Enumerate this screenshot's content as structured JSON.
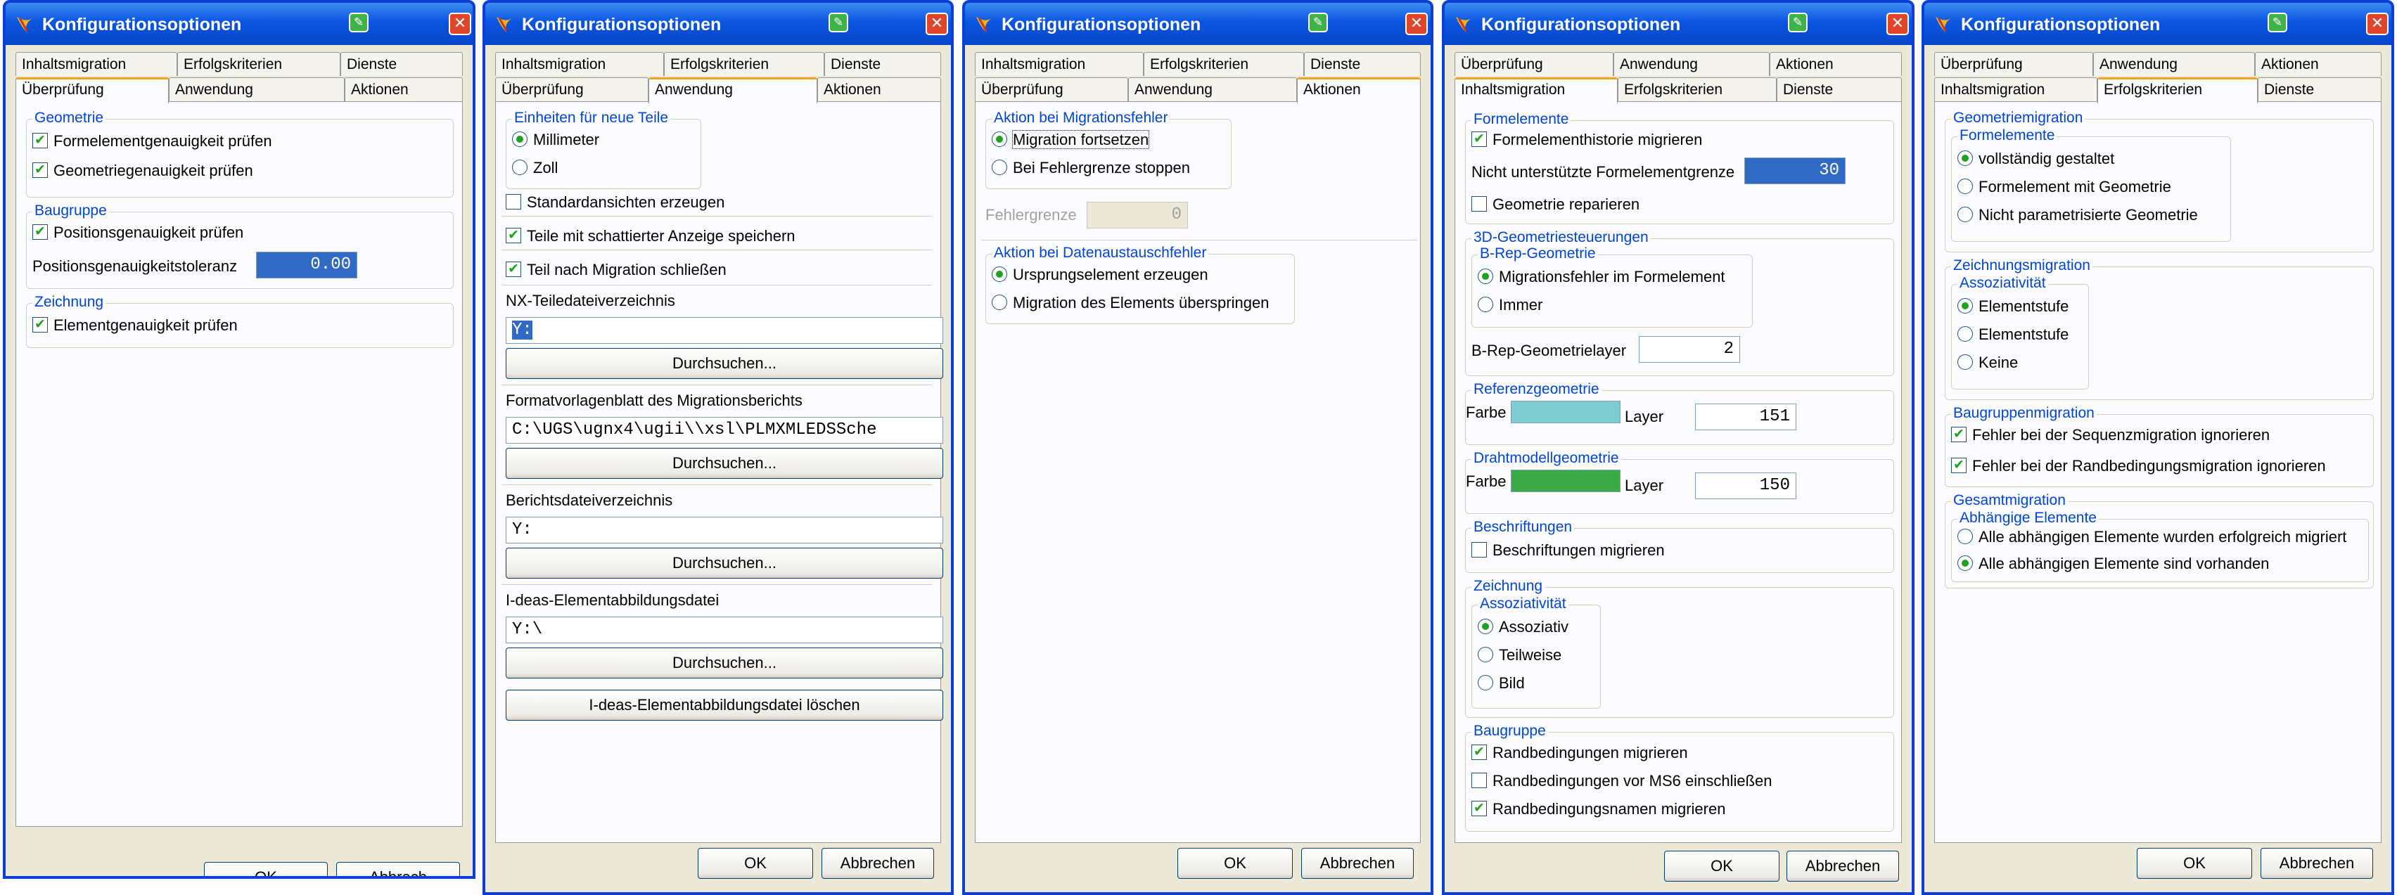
{
  "window_title": "Konfigurationsoptionen",
  "buttons": {
    "ok": "OK",
    "cancel": "Abbrechen",
    "cancel_partial": "Abbrech"
  },
  "tabs": {
    "inhaltsmigration": "Inhaltsmigration",
    "erfolgskriterien": "Erfolgskriterien",
    "dienste": "Dienste",
    "ueberpruefung": "Überprüfung",
    "anwendung": "Anwendung",
    "aktionen": "Aktionen"
  },
  "d1": {
    "geometrie": {
      "title": "Geometrie",
      "formelement": "Formelementgenauigkeit prüfen",
      "geometrie_pruefen": "Geometriegenauigkeit prüfen"
    },
    "baugruppe": {
      "title": "Baugruppe",
      "position": "Positionsgenauigkeit prüfen",
      "tol_label": "Positionsgenauigkeitstoleranz",
      "tol_value": "0.00"
    },
    "zeichnung": {
      "title": "Zeichnung",
      "element": "Elementgenauigkeit prüfen"
    }
  },
  "d2": {
    "einheiten": {
      "title": "Einheiten für neue Teile",
      "mm": "Millimeter",
      "zoll": "Zoll"
    },
    "standardansichten": "Standardansichten erzeugen",
    "schattiert": "Teile mit schattierter Anzeige speichern",
    "schliessen": "Teil nach Migration schließen",
    "nx_label": "NX-Teiledateiverzeichnis",
    "nx_value": "Y:",
    "browse": "Durchsuchen...",
    "format_label": "Formatvorlagenblatt des Migrationsberichts",
    "format_value": "C:\\UGS\\ugnx4\\ugii\\\\xsl\\PLMXMLEDSSche",
    "bericht_label": "Berichtsdateiverzeichnis",
    "bericht_value": "Y:",
    "ideas_label": "I-deas-Elementabbildungsdatei",
    "ideas_value": "Y:\\",
    "ideas_delete": "I-deas-Elementabbildungsdatei löschen"
  },
  "d3": {
    "migfehler": {
      "title": "Aktion bei Migrationsfehler",
      "fortsetzen": "Migration fortsetzen",
      "stoppen": "Bei Fehlergrenze stoppen"
    },
    "fehlergrenze_label": "Fehlergrenze",
    "fehlergrenze_value": "0",
    "datenfehler": {
      "title": "Aktion bei Datenaustauschfehler",
      "ursprung": "Ursprungselement erzeugen",
      "ueberspringen": "Migration des Elements überspringen"
    }
  },
  "d4": {
    "formelemente": {
      "title": "Formelemente",
      "historie": "Formelementhistorie migrieren",
      "grenze_label": "Nicht unterstützte Formelementgrenze",
      "grenze_value": "30",
      "reparieren": "Geometrie reparieren"
    },
    "geo3d": {
      "title": "3D-Geometriesteuerungen",
      "brep_title": "B-Rep-Geometrie",
      "fehler": "Migrationsfehler im Formelement",
      "immer": "Immer",
      "layer_label": "B-Rep-Geometrielayer",
      "layer_value": "2"
    },
    "referenz": {
      "title": "Referenzgeometrie",
      "farbe": "Farbe",
      "layer": "Layer",
      "layer_value": "151",
      "color": "#7ecbd0"
    },
    "draht": {
      "title": "Drahtmodellgeometrie",
      "farbe": "Farbe",
      "layer": "Layer",
      "layer_value": "150",
      "color": "#3aaa45"
    },
    "beschriftungen": {
      "title": "Beschriftungen",
      "migrieren": "Beschriftungen migrieren"
    },
    "zeichnung": {
      "title": "Zeichnung",
      "assoz_title": "Assoziativität",
      "assoziativ": "Assoziativ",
      "teilweise": "Teilweise",
      "bild": "Bild"
    },
    "baugruppe": {
      "title": "Baugruppe",
      "randbed": "Randbedingungen migrieren",
      "ms6": "Randbedingungen vor MS6 einschließen",
      "namen": "Randbedingungsnamen migrieren"
    }
  },
  "d5": {
    "geomig": {
      "title": "Geometriemigration",
      "fe_title": "Formelemente",
      "vollstaendig": "vollständig gestaltet",
      "mit_geometrie": "Formelement mit Geometrie",
      "nicht_param": "Nicht parametrisierte Geometrie"
    },
    "zeichnungmig": {
      "title": "Zeichnungsmigration",
      "assoz_title": "Assoziativität",
      "stufe1": "Elementstufe",
      "stufe2": "Elementstufe",
      "keine": "Keine"
    },
    "baugruppenmig": {
      "title": "Baugruppenmigration",
      "sequenz": "Fehler bei der Sequenzmigration ignorieren",
      "randbed": "Fehler bei der Randbedingungsmigration ignorieren"
    },
    "gesamt": {
      "title": "Gesamtmigration",
      "abh_title": "Abhängige Elemente",
      "erfolgreich": "Alle abhängigen Elemente wurden erfolgreich migriert",
      "vorhanden": "Alle abhängigen Elemente sind vorhanden"
    }
  }
}
